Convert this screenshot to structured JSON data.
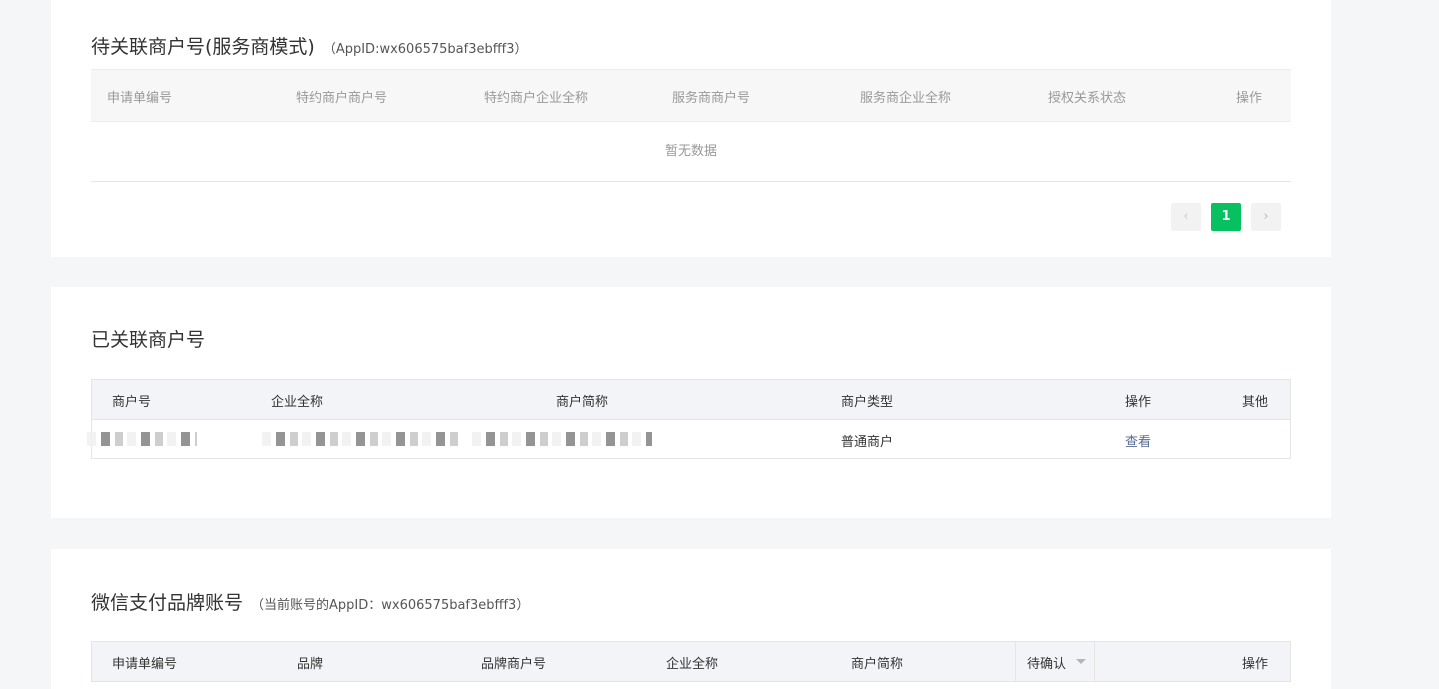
{
  "pending": {
    "title": "待关联商户号(服务商模式)",
    "subtitle": "（AppID:wx606575baf3ebfff3）",
    "columns": [
      "申请单编号",
      "特约商户商户号",
      "特约商户企业全称",
      "服务商商户号",
      "服务商企业全称",
      "授权关系状态",
      "操作"
    ],
    "empty_text": "暂无数据",
    "pagination": {
      "prev": "‹",
      "current": "1",
      "next": "›"
    }
  },
  "linked": {
    "title": "已关联商户号",
    "columns": [
      "商户号",
      "企业全称",
      "商户简称",
      "商户类型",
      "操作",
      "其他"
    ],
    "rows": [
      {
        "merchant_type": "普通商户",
        "action": "查看"
      }
    ]
  },
  "brand": {
    "title": "微信支付品牌账号",
    "subtitle": "（当前账号的AppID：wx606575baf3ebfff3）",
    "columns": [
      "申请单编号",
      "品牌",
      "品牌商户号",
      "企业全称",
      "商户简称",
      "待确认",
      "操作"
    ]
  },
  "colors": {
    "accent": "#07c160",
    "link": "#576b95"
  }
}
